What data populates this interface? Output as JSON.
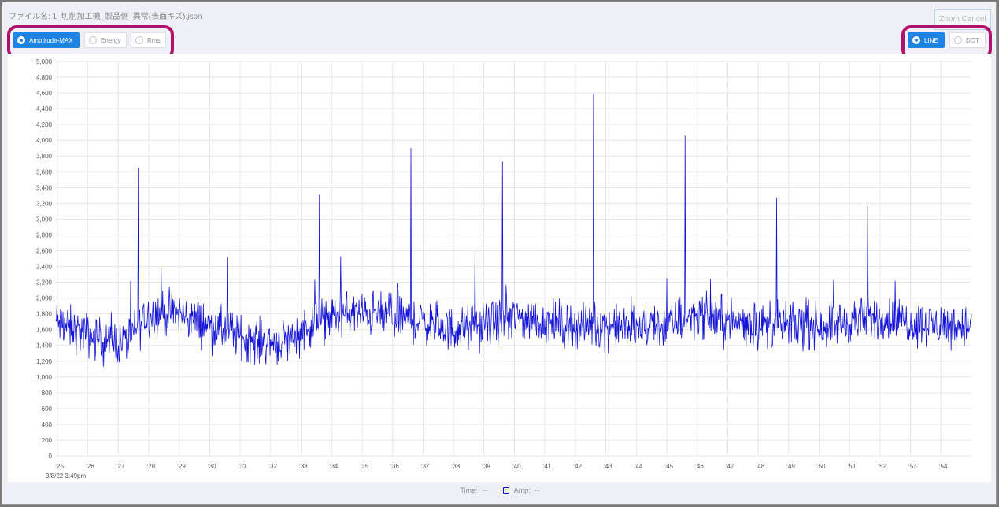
{
  "header": {
    "file_label": "ファイル名: 1_切削加工機_製品側_異常(表面キズ).json",
    "zoom_cancel": "Zoom Cancel"
  },
  "metric_options": [
    {
      "label": "Amplitude-MAX",
      "selected": true
    },
    {
      "label": "Energy",
      "selected": false
    },
    {
      "label": "Rms",
      "selected": false
    }
  ],
  "mode_options": [
    {
      "label": "LINE",
      "selected": true
    },
    {
      "label": "DOT",
      "selected": false
    }
  ],
  "footer": {
    "time_label": "Time:",
    "time_value": "--",
    "amp_label": "Amp:",
    "amp_value": "--"
  },
  "colors": {
    "accent": "#1f83e6",
    "series": "#1414d6",
    "highlight": "#b0126e"
  },
  "chart_data": {
    "type": "line",
    "xlabel_start": "3/8/22 3:49pm",
    "ylim": [
      0,
      5000
    ],
    "y_ticks": [
      0,
      200,
      400,
      600,
      800,
      1000,
      1200,
      1400,
      1600,
      1800,
      2000,
      2200,
      2400,
      2600,
      2800,
      3000,
      3200,
      3400,
      3600,
      3800,
      4000,
      4200,
      4400,
      4600,
      4800,
      5000
    ],
    "x_ticks": [
      ":25",
      ":26",
      ":27",
      ":28",
      ":29",
      ":30",
      ":31",
      ":32",
      ":33",
      ":34",
      ":35",
      ":36",
      ":37",
      ":38",
      ":39",
      ":40",
      ":41",
      ":42",
      ":43",
      ":44",
      ":45",
      ":46",
      ":47",
      ":48",
      ":49",
      ":50",
      ":51",
      ":52",
      ":53",
      ":54"
    ],
    "xlim": [
      24.95,
      55.0
    ],
    "grid": true,
    "series": [
      {
        "baseline": [
          [
            24.95,
            1700
          ],
          [
            25.5,
            1600
          ],
          [
            26.5,
            1450
          ],
          [
            27.3,
            1450
          ],
          [
            28.0,
            1800
          ],
          [
            29.0,
            1800
          ],
          [
            30.0,
            1650
          ],
          [
            31.5,
            1450
          ],
          [
            32.5,
            1450
          ],
          [
            33.5,
            1700
          ],
          [
            34.5,
            1800
          ],
          [
            35.5,
            1800
          ],
          [
            37.0,
            1700
          ],
          [
            38.0,
            1600
          ],
          [
            39.0,
            1650
          ],
          [
            40.0,
            1750
          ],
          [
            41.0,
            1700
          ],
          [
            42.0,
            1650
          ],
          [
            43.0,
            1650
          ],
          [
            44.0,
            1600
          ],
          [
            45.0,
            1650
          ],
          [
            46.0,
            1800
          ],
          [
            47.0,
            1700
          ],
          [
            48.0,
            1650
          ],
          [
            49.0,
            1650
          ],
          [
            50.0,
            1650
          ],
          [
            51.0,
            1700
          ],
          [
            52.0,
            1750
          ],
          [
            53.0,
            1700
          ],
          [
            54.0,
            1650
          ],
          [
            55.0,
            1650
          ]
        ],
        "spikes": [
          [
            27.65,
            3650
          ],
          [
            30.58,
            2520
          ],
          [
            33.6,
            3310
          ],
          [
            34.3,
            2530
          ],
          [
            36.6,
            3900
          ],
          [
            38.7,
            2600
          ],
          [
            39.6,
            3730
          ],
          [
            42.6,
            4580
          ],
          [
            45.6,
            4060
          ],
          [
            48.6,
            3270
          ],
          [
            51.6,
            3160
          ],
          [
            28.4,
            2400
          ],
          [
            45.0,
            2250
          ],
          [
            52.5,
            2220
          ]
        ],
        "noise_amplitude": 230,
        "samples": 1800
      }
    ]
  }
}
